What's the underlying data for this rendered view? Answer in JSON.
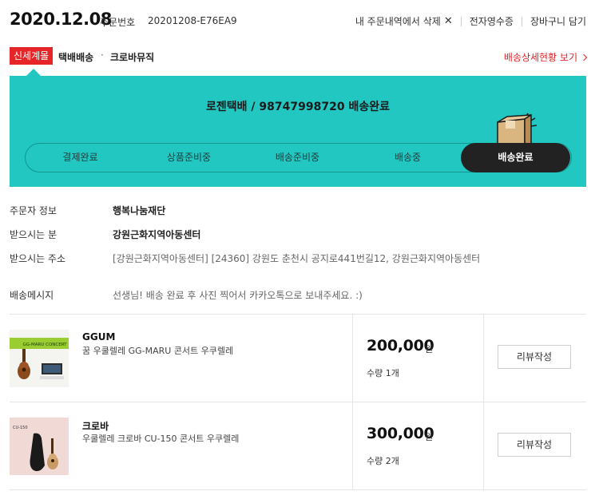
{
  "header": {
    "order_date": "2020.12.08",
    "order_no_label": "주문번호",
    "order_no": "20201208-E76EA9",
    "actions": {
      "delete_label": "내 주문내역에서 삭제",
      "receipt_label": "전자영수증",
      "cart_label": "장바구니 담기"
    }
  },
  "store": {
    "badge": "신세계몰",
    "ship_type": "택배배송",
    "separator": "·",
    "brand": "크로바뮤직",
    "detail_link": "배송상세현황 보기"
  },
  "tracker": {
    "carrier_status": "로젠택배 / 98747998720 배송완료",
    "steps": [
      "결제완료",
      "상품준비중",
      "배송준비중",
      "배송중",
      "배송완료"
    ],
    "active_step": "배송완료"
  },
  "info": {
    "orderer_label": "주문자 정보",
    "orderer_value": "행복나눔재단",
    "receiver_label": "받으시는 분",
    "receiver_value": "강원근화지역아동센터",
    "address_label": "받으시는 주소",
    "address_value": "[강원근화지역아동센터] [24360] 강원도 춘천시 공지로441번길12, 강원근화지역아동센터",
    "message_label": "배송메시지",
    "message_value": "선생님! 배송 완료 후 사진 찍어서 카카오톡으로 보내주세요. :)"
  },
  "products": [
    {
      "brand": "GGUM",
      "name": "꿈 우쿨렐레 GG-MARU 콘서트 우쿠렐레",
      "thumb_text": "GG-MARU CONCERT",
      "price": "200,000",
      "currency": "원",
      "qty": "수량 1개",
      "review_label": "리뷰작성"
    },
    {
      "brand": "크로바",
      "name": "우쿨렐레 크로바 CU-150 콘서트 우쿠렐레",
      "thumb_text": "CU-150",
      "price": "300,000",
      "currency": "원",
      "qty": "수량 2개",
      "review_label": "리뷰작성"
    }
  ],
  "colors": {
    "accent_red": "#e52528",
    "tracker_teal": "#22c7c2",
    "active_step_bg": "#222222"
  },
  "icons": {
    "delete": "close-icon",
    "detail": "chevron-right-icon",
    "delivered": "package-box-icon"
  }
}
